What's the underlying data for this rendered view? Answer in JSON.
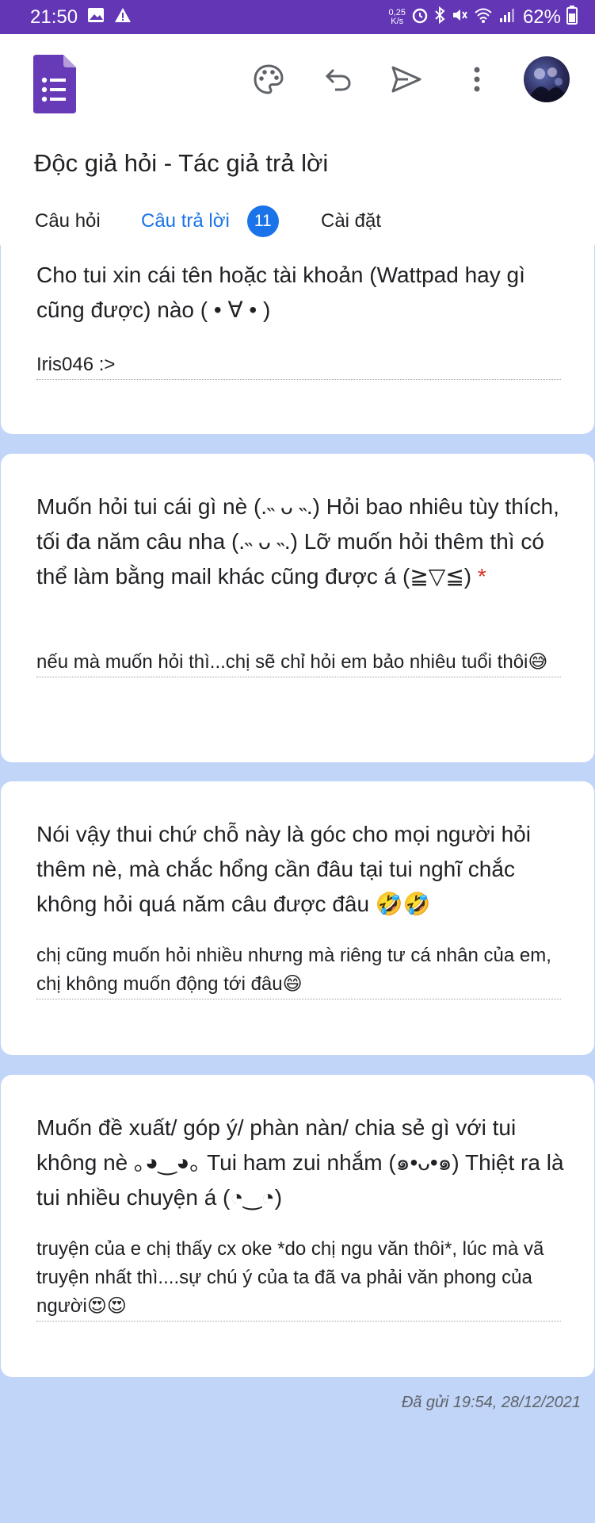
{
  "status_bar": {
    "time": "21:50",
    "speed_value": "0,25",
    "speed_unit": "K/s",
    "battery": "62%"
  },
  "app_bar": {
    "form_title": "Độc giả hỏi - Tác giả trả lời",
    "tabs": [
      {
        "label": "Câu hỏi"
      },
      {
        "label": "Câu trả lời",
        "badge": "11"
      },
      {
        "label": "Cài đặt"
      }
    ],
    "accent_color": "#1a73e8",
    "icons": [
      "forms-logo-icon",
      "palette-icon",
      "undo-icon",
      "send-icon",
      "more-vert-icon",
      "avatar"
    ]
  },
  "responses": [
    {
      "question": "Cho tui xin cái tên hoặc tài khoản (Wattpad hay gì cũng được) nào ( • ∀ • )",
      "answer": "Iris046 :>"
    },
    {
      "question": "Muốn hỏi tui cái gì nè (.˵ ᴗ ˵.) Hỏi bao nhiêu tùy thích, tối đa năm câu nha (.˵ ᴗ ˵.) Lỡ muốn hỏi thêm thì có thể làm bằng mail khác cũng được á (≧▽≦)",
      "required_mark": "*",
      "answer": "nếu mà muốn hỏi thì...chị sẽ chỉ hỏi em bảo nhiêu tuổi thôi😅"
    },
    {
      "question": "Nói vậy thui chứ chỗ này là góc cho mọi người hỏi thêm nè, mà chắc hổng cần đâu tại tui nghĩ chắc không hỏi quá năm câu được đâu 🤣🤣",
      "answer": "chị cũng muốn hỏi nhiều nhưng mà riêng tư cá nhân của em, chị không muốn động tới đâu😄"
    },
    {
      "question": "Muốn đề xuất/ góp ý/ phàn nàn/ chia sẻ gì với tui không nè ｡◕‿◕｡ Tui ham zui nhắm (๑•ᴗ•๑) Thiệt ra là tui nhiều chuyện á (◔‿◔)",
      "answer": "truyện của e chị thấy cx oke *do chị ngu văn thôi*, lúc mà vã truyện nhất thì....sự chú ý của ta đã va phải văn phong của người😍😍"
    }
  ],
  "submitted": "Đã gửi 19:54, 28/12/2021"
}
